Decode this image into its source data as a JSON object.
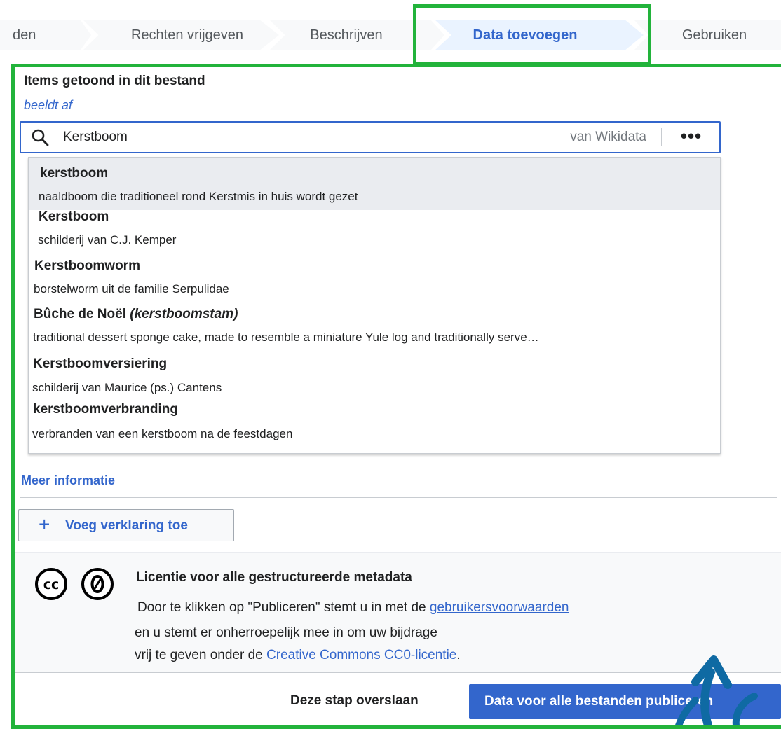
{
  "steps": [
    {
      "label": "den"
    },
    {
      "label": "Rechten vrijgeven"
    },
    {
      "label": "Beschrijven"
    },
    {
      "label": "Data toevoegen"
    },
    {
      "label": "Gebruiken"
    }
  ],
  "section": {
    "title": "Items getoond in dit bestand",
    "property_label": "beeldt af"
  },
  "search": {
    "value": "Kerstboom",
    "source_label": "van Wikidata",
    "more_label": "•••",
    "icon": "search-icon"
  },
  "suggestions": [
    {
      "title": "kerstboom",
      "alias": "",
      "description": "naaldboom die traditioneel rond Kerstmis in huis wordt gezet"
    },
    {
      "title": "Kerstboom",
      "alias": "",
      "description": "schilderij van C.J. Kemper"
    },
    {
      "title": "Kerstboomworm",
      "alias": "",
      "description": "borstelworm uit de familie Serpulidae"
    },
    {
      "title": "Bûche de Noël",
      "alias": "(kerstboomstam)",
      "description": "traditional dessert sponge cake, made to resemble a miniature Yule log and traditionally serve…"
    },
    {
      "title": "Kerstboomversiering",
      "alias": "",
      "description": "schilderij van Maurice (ps.) Cantens"
    },
    {
      "title": "kerstboomverbranding",
      "alias": "",
      "description": "verbranden van een kerstboom na de feestdagen"
    }
  ],
  "more_info": "Meer informatie",
  "add_statement": {
    "icon": "plus-icon",
    "label": "Voeg verklaring toe"
  },
  "license": {
    "icons": [
      "cc-icon",
      "zero-icon"
    ],
    "title": "Licentie voor alle gestructureerde metadata",
    "line1_prefix": "Door te klikken op \"Publiceren\" stemt u in met de ",
    "line1_link": "gebruikersvoorwaarden",
    "line2": "en u stemt er onherroepelijk mee in om uw bijdrage",
    "line3_prefix": "vrij te geven onder de ",
    "line3_link": "Creative Commons CC0-licentie",
    "line3_suffix": "."
  },
  "footer": {
    "skip_label": "Deze stap overslaan",
    "publish_label": "Data voor alle bestanden publiceren"
  },
  "colors": {
    "accent": "#3366cc",
    "highlight": "#22b33b",
    "arrow": "#0f6aa3"
  }
}
